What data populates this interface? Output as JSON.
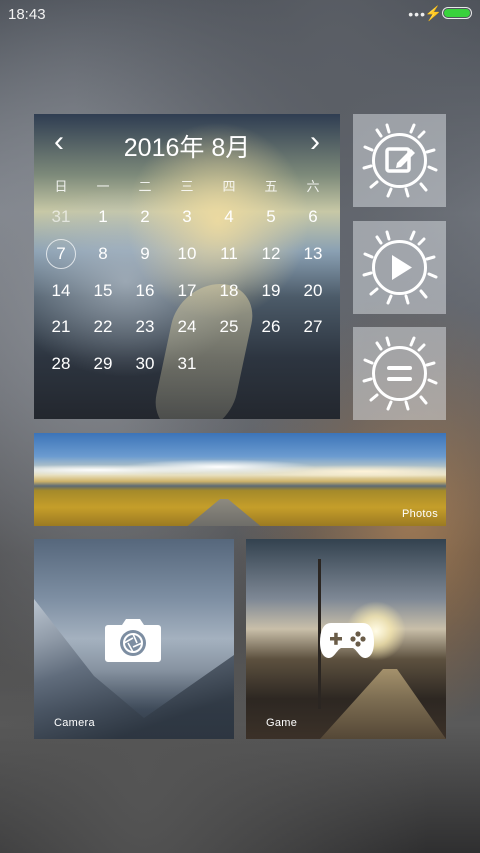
{
  "status_bar": {
    "time": "18:43",
    "dots": "•••",
    "charging": "⚡",
    "battery_level": 1.0,
    "battery_color": "#39d23c"
  },
  "calendar": {
    "title": "2016年 8月",
    "prev": "‹",
    "next": "›",
    "weekdays": [
      "日",
      "一",
      "二",
      "三",
      "四",
      "五",
      "六"
    ],
    "weeks": [
      [
        "31",
        "1",
        "2",
        "3",
        "4",
        "5",
        "6"
      ],
      [
        "7",
        "8",
        "9",
        "10",
        "11",
        "12",
        "13"
      ],
      [
        "14",
        "15",
        "16",
        "17",
        "18",
        "19",
        "20"
      ],
      [
        "21",
        "22",
        "23",
        "24",
        "25",
        "26",
        "27"
      ],
      [
        "28",
        "29",
        "30",
        "31",
        "",
        "",
        ""
      ]
    ],
    "today": "7"
  },
  "side_tiles": [
    "note-edit-icon",
    "play-icon",
    "menu-icon"
  ],
  "photos": {
    "label": "Photos"
  },
  "camera": {
    "label": "Camera",
    "icon": "camera-icon"
  },
  "game": {
    "label": "Game",
    "icon": "gamepad-icon"
  }
}
